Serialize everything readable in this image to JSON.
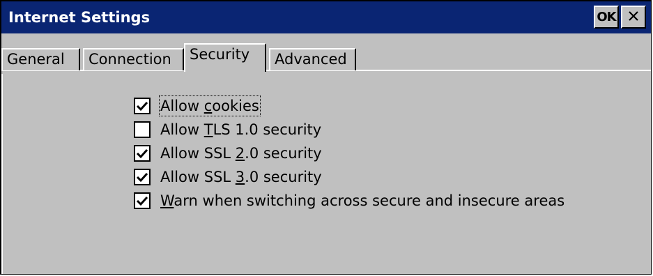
{
  "window": {
    "title": "Internet Settings",
    "ok_label": "OK",
    "close_glyph": "×",
    "close_icon": "close-icon",
    "title_bar_color": "#0a2573",
    "face_color": "#c0c0c0"
  },
  "tabs": [
    {
      "label": "General",
      "active": false
    },
    {
      "label": "Connection",
      "active": false
    },
    {
      "label": "Security",
      "active": true
    },
    {
      "label": "Advanced",
      "active": false
    }
  ],
  "security": {
    "options": [
      {
        "label_before": "Allow ",
        "mnemonic": "c",
        "label_after": "ookies",
        "checked": true,
        "focused": true
      },
      {
        "label_before": "Allow ",
        "mnemonic": "T",
        "label_after": "LS 1.0 security",
        "checked": false,
        "focused": false
      },
      {
        "label_before": "Allow SSL ",
        "mnemonic": "2",
        "label_after": ".0 security",
        "checked": true,
        "focused": false
      },
      {
        "label_before": "Allow SSL ",
        "mnemonic": "3",
        "label_after": ".0 security",
        "checked": true,
        "focused": false
      },
      {
        "label_before": "",
        "mnemonic": "W",
        "label_after": "arn when switching across secure and insecure areas",
        "checked": true,
        "focused": false
      }
    ]
  }
}
